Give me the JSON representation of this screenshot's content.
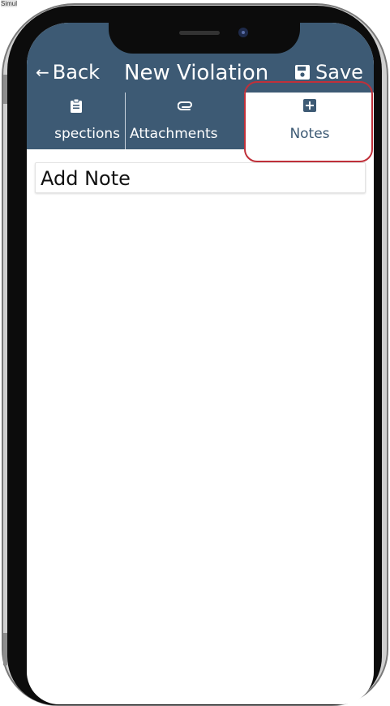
{
  "simulator": {
    "label": "Simul"
  },
  "header": {
    "back_arrow": "←",
    "back_label": "Back",
    "title": "New Violation",
    "save_label": "Save",
    "background_color": "#3d5a74"
  },
  "tabs": [
    {
      "label": "spections",
      "icon": "clipboard-icon"
    },
    {
      "label": "Attachments",
      "icon": "paperclip-icon"
    },
    {
      "label": "Notes",
      "icon": "plus-square-icon",
      "selected": true
    }
  ],
  "main": {
    "add_note_label": "Add Note"
  },
  "colors": {
    "accent": "#3d5a74",
    "highlight": "#c0303a"
  }
}
